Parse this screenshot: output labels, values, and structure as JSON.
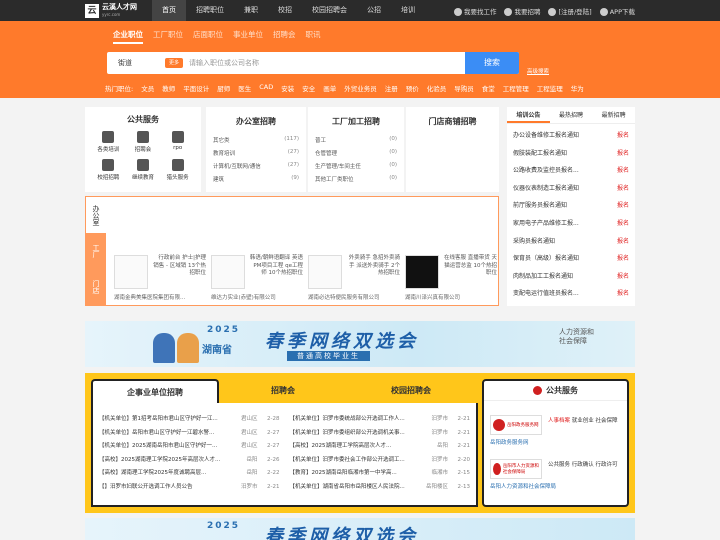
{
  "brand": {
    "name": "云溪人才网",
    "sub": "yyrc.com"
  },
  "nav": [
    "首页",
    "招聘职位",
    "兼职",
    "校招",
    "校园招聘会",
    "公招",
    "培训"
  ],
  "toplinks": [
    "我要找工作",
    "我要招聘",
    "[注册/登陆]",
    "APP下载"
  ],
  "search": {
    "tabs": [
      "企业职位",
      "工厂职位",
      "店面职位",
      "事业单位",
      "招聘会",
      "职讯"
    ],
    "city": "街道",
    "tag": "更多",
    "placeholder": "请输入职位或公司名称",
    "button": "搜索",
    "advanced": "高级搜索"
  },
  "hot": {
    "label": "热门职位:",
    "items": [
      "文员",
      "教师",
      "平面设计",
      "厨师",
      "医生",
      "CAD",
      "安装",
      "安全",
      "画单",
      "外贸业务员",
      "注册",
      "预价",
      "化验员",
      "导购员",
      "食堂",
      "工程管理",
      "工程监理",
      "华为"
    ]
  },
  "public_service": {
    "title": "公共服务",
    "items": [
      "各类培训",
      "招聘会",
      "rpo",
      "校招招聘",
      "继续教育",
      "猎头服务"
    ]
  },
  "categories": [
    {
      "title": "办公室招聘",
      "rows": [
        [
          "其它类",
          "(117)"
        ],
        [
          "教育培训",
          "(27)"
        ],
        [
          "计算机/互联网/通信",
          "(27)"
        ],
        [
          "建筑",
          "(9)"
        ]
      ]
    },
    {
      "title": "工厂加工招聘",
      "rows": [
        [
          "普工",
          "(0)"
        ],
        [
          "仓管管理",
          "(0)"
        ],
        [
          "生产管理/车间主任",
          "(0)"
        ],
        [
          "其他工厂类职位",
          "(0)"
        ]
      ]
    },
    {
      "title": "门店商铺招聘",
      "rows": []
    }
  ],
  "notice": {
    "tabs": [
      "培训公告",
      "最热招聘",
      "最新招聘"
    ],
    "items": [
      {
        "t": "办公设备维修工报名通知",
        "s": "报名"
      },
      {
        "t": "假肢装配工报名通知",
        "s": "报名"
      },
      {
        "t": "公路收费及监控员报名...",
        "s": "报名"
      },
      {
        "t": "仪器仪表制造工报名通知",
        "s": "报名"
      },
      {
        "t": "前厅服务员报名通知",
        "s": "报名"
      },
      {
        "t": "家用电子产品维修工报...",
        "s": "报名"
      },
      {
        "t": "采购员报名通知",
        "s": "报名"
      },
      {
        "t": "保育员（高级）报名通知",
        "s": "报名"
      },
      {
        "t": "肉制品加工工报名通知",
        "s": "报名"
      },
      {
        "t": "变配电运行值班员报名...",
        "s": "报名"
      }
    ]
  },
  "strip": {
    "vtabs": [
      "办公室",
      "工厂",
      "门店"
    ],
    "companies": [
      {
        "desc": "行政前台 护士|护理 销售 - 区域销 13个热招职位",
        "name": "湖南金典美集医院集团有限..."
      },
      {
        "desc": "韩语/朝鲜语翻译 英语PM项目工程 qe工程师 10个热招职位",
        "name": "维达力实业(赤壁)有限公司"
      },
      {
        "desc": "外卖骑手 急招外卖骑手 派送外卖骑手 2个热招职位",
        "name": "湖南必达特便民服务有限公司"
      },
      {
        "desc": "在线客服 直播带货 天猫运营总监 10个热招职位",
        "name": "湖南川泽兴真有限公司"
      }
    ]
  },
  "banner": {
    "year": "2025",
    "province": "湖南省",
    "main": "春季网络双选会",
    "sub": "普通高校毕业生",
    "side": "人力资源和社会保障"
  },
  "lower": {
    "tabs": [
      "企事业单位招聘",
      "招聘会",
      "校园招聘会"
    ],
    "left": [
      {
        "t": "【机关单位】第1招考岳阳市君山区守护好一江...",
        "p": "君山区",
        "d": "2-28"
      },
      {
        "t": "【机关单位】岳阳市君山区守护好一江碧水警...",
        "p": "君山区",
        "d": "2-27"
      },
      {
        "t": "【机关单位】2025湖南岳阳市君山区守护好一...",
        "p": "君山区",
        "d": "2-27"
      },
      {
        "t": "【高校】2025湖南理工学院2025年高层次人才...",
        "p": "岳阳",
        "d": "2-26"
      },
      {
        "t": "【高校】湖南理工学院2025年度诚聘高层...",
        "p": "岳阳",
        "d": "2-22"
      },
      {
        "t": "【】汨罗市妇联公开选调工作人员公告",
        "p": "汨罗市",
        "d": "2-21"
      }
    ],
    "right": [
      {
        "t": "【机关单位】汨罗市委统战部公开选调工作人...",
        "p": "汨罗市",
        "d": "2-21"
      },
      {
        "t": "【机关单位】汨罗市委组织部公开选调机关事...",
        "p": "汨罗市",
        "d": "2-21"
      },
      {
        "t": "【高校】2025湖南理工学院高层次人才...",
        "p": "岳阳",
        "d": "2-21"
      },
      {
        "t": "【机关单位】汨罗市委社会工作部公开选调工...",
        "p": "汨罗市",
        "d": "2-20"
      },
      {
        "t": "【教育】2025湖南岳阳临湘市第一中学高...",
        "p": "临湘市",
        "d": "2-15"
      },
      {
        "t": "【机关单位】湖南省岳阳市岳阳楼区人民法院...",
        "p": "岳阳楼区",
        "d": "2-13"
      }
    ],
    "public": {
      "title": "公共服务",
      "items": [
        {
          "emb": "岳阳政务服务网",
          "desc_red": "人事档案",
          "desc": "就业创业 社会保障",
          "name": "岳阳政务服务网"
        },
        {
          "emb": "岳阳市人力资源和社会保障局",
          "desc_red": "",
          "desc": "公共服务 行政确认 行政许可",
          "name": "岳阳人力资源和社会保障局"
        }
      ]
    }
  },
  "banner2": {
    "year": "2025",
    "main": "春季网络双选会"
  }
}
